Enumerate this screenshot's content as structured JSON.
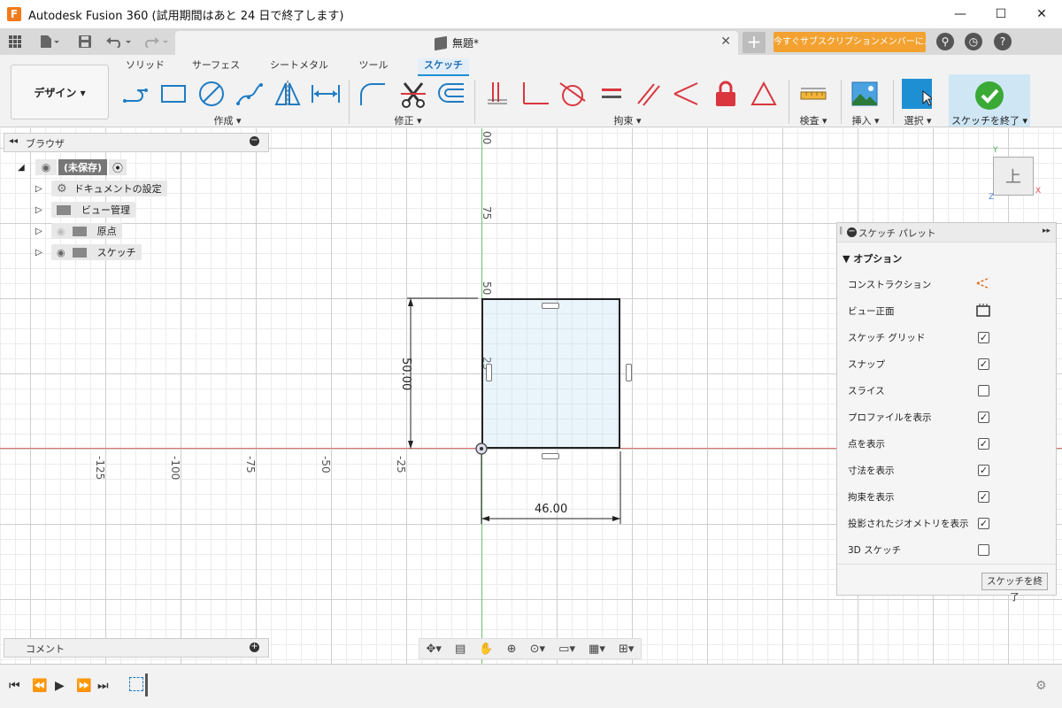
{
  "window": {
    "title": "Autodesk Fusion 360 (試用期間はあと 24 日で終了します)",
    "app_icon": "F",
    "min_label": "—",
    "max_label": "☐",
    "close_label": "✕"
  },
  "quickbar": {
    "doc_tab_title": "無題*",
    "doc_tab_close": "✕",
    "new_tab": "+",
    "trial_button": "今すぐサブスクリプションメンバーに..."
  },
  "ribbon": {
    "workspace": "デザイン ▾",
    "tabs": [
      "ソリッド",
      "サーフェス",
      "シートメタル",
      "ツール",
      "スケッチ"
    ],
    "active_tab": "スケッチ",
    "groups": {
      "create": "作成 ▾",
      "modify": "修正 ▾",
      "constraints": "拘束 ▾",
      "inspect": "検査 ▾",
      "insert": "挿入 ▾",
      "select": "選択 ▾",
      "finish": "スケッチを終了 ▾"
    }
  },
  "browser": {
    "title": "ブラウザ",
    "root": "(未保存)",
    "items": [
      "ドキュメントの設定",
      "ビュー管理",
      "原点",
      "スケッチ"
    ]
  },
  "comments": {
    "title": "コメント"
  },
  "canvas": {
    "x_ticks": [
      "-125",
      "-100",
      "-75",
      "-50",
      "-25"
    ],
    "y_ticks": [
      "00",
      "75",
      "50",
      "25"
    ],
    "dim_vertical": "50.00",
    "dim_horizontal": "46.00"
  },
  "viewcube": {
    "face": "上",
    "x_label": "X",
    "y_label": "Y",
    "z_label": "Z"
  },
  "palette": {
    "title": "スケッチ パレット",
    "section": "オプション",
    "options": [
      {
        "label": "コンストラクション",
        "type": "icon",
        "checked": null
      },
      {
        "label": "ビュー正面",
        "type": "icon",
        "checked": null
      },
      {
        "label": "スケッチ グリッド",
        "type": "check",
        "checked": true
      },
      {
        "label": "スナップ",
        "type": "check",
        "checked": true
      },
      {
        "label": "スライス",
        "type": "check",
        "checked": false
      },
      {
        "label": "プロファイルを表示",
        "type": "check",
        "checked": true
      },
      {
        "label": "点を表示",
        "type": "check",
        "checked": true
      },
      {
        "label": "寸法を表示",
        "type": "check",
        "checked": true
      },
      {
        "label": "拘束を表示",
        "type": "check",
        "checked": true
      },
      {
        "label": "投影されたジオメトリを表示",
        "type": "check",
        "checked": true
      },
      {
        "label": "3D スケッチ",
        "type": "check",
        "checked": false
      }
    ],
    "finish_button": "スケッチを終了"
  },
  "colors": {
    "accent": "#1f8fd4",
    "trial": "#f3a231",
    "finish_check": "#3aa935",
    "constraint_red": "#d9363e"
  }
}
